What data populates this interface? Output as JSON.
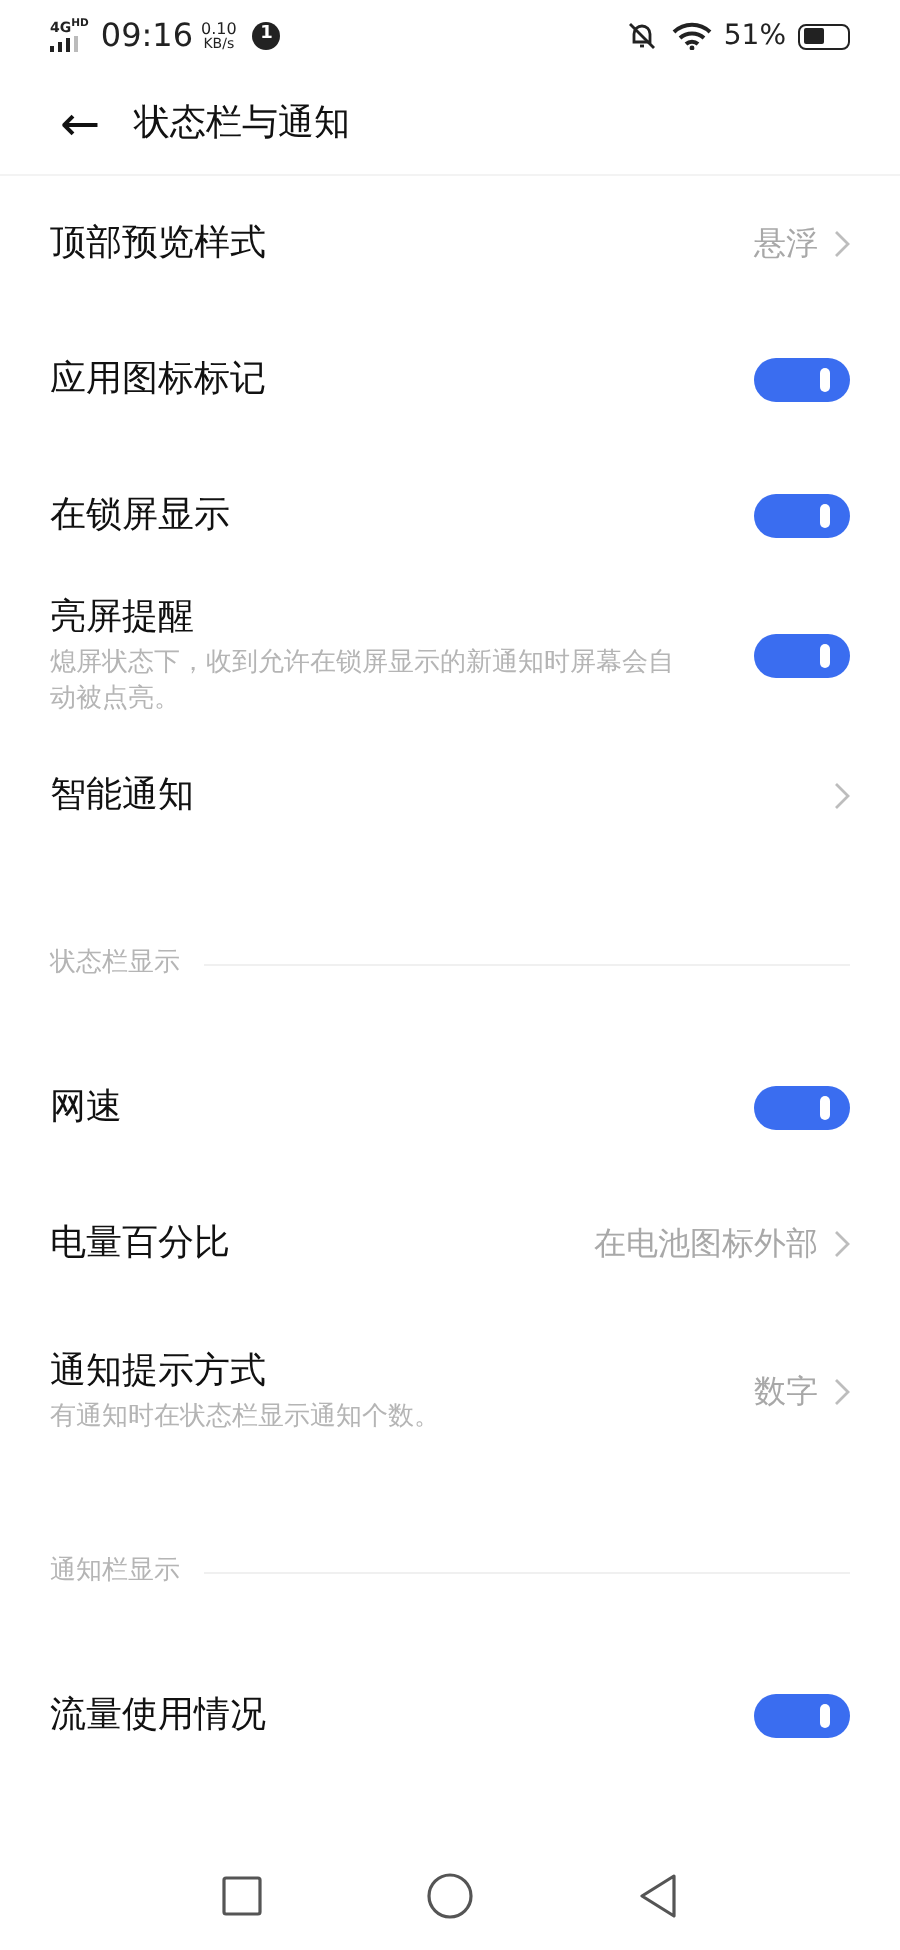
{
  "status_bar": {
    "network": "4G",
    "network_sup": "HD",
    "time": "09:16",
    "speed_value": "0.10",
    "speed_unit": "KB/s",
    "notification_badge": "1",
    "battery": "51%"
  },
  "header": {
    "back": "←",
    "title": "状态栏与通知"
  },
  "items": [
    {
      "kind": "link",
      "label": "顶部预览样式",
      "value": "悬浮"
    },
    {
      "kind": "toggle",
      "label": "应用图标标记",
      "on": true
    },
    {
      "kind": "toggle",
      "label": "在锁屏显示",
      "on": true
    },
    {
      "kind": "toggle",
      "label": "亮屏提醒",
      "subtitle": "熄屏状态下，收到允许在锁屏显示的新通知时屏幕会自动被点亮。",
      "on": true
    },
    {
      "kind": "link",
      "label": "智能通知"
    },
    {
      "kind": "section",
      "label": "状态栏显示"
    },
    {
      "kind": "toggle",
      "label": "网速",
      "on": true
    },
    {
      "kind": "link",
      "label": "电量百分比",
      "value": "在电池图标外部"
    },
    {
      "kind": "link",
      "label": "通知提示方式",
      "subtitle": "有通知时在状态栏显示通知个数。",
      "value": "数字"
    },
    {
      "kind": "section",
      "label": "通知栏显示"
    },
    {
      "kind": "toggle",
      "label": "流量使用情况",
      "on": true
    }
  ]
}
